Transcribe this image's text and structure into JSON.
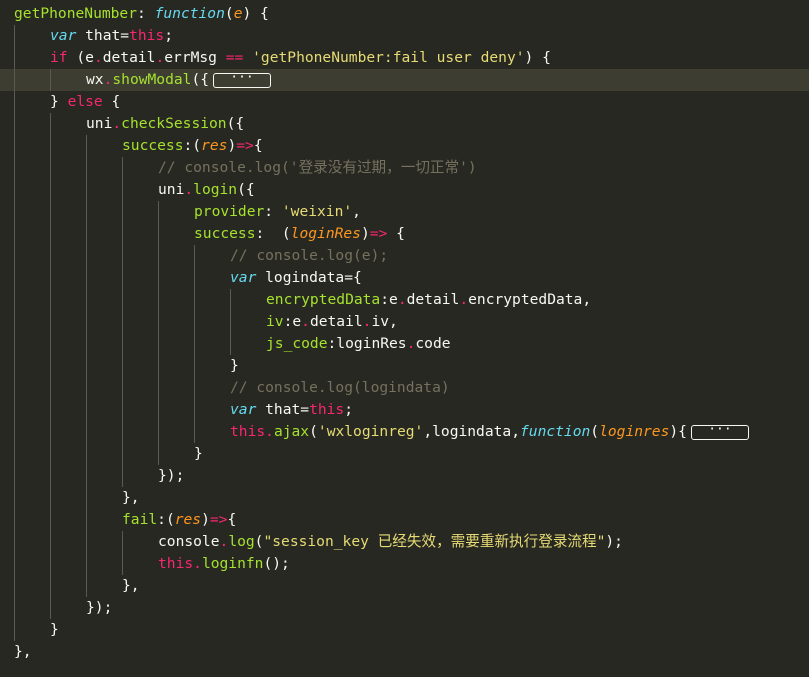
{
  "colors": {
    "background": "#272822",
    "keyword": "#f92672",
    "plain": "#f8f8f2",
    "function_name": "#a6e22e",
    "storage": "#66d9ef",
    "string": "#e6db74",
    "param": "#fd971f",
    "comment": "#75715e",
    "punct": "#f8f8f2"
  },
  "code_lines": [
    {
      "indent": 0,
      "tokens": [
        [
          "getPhoneNumber",
          "function_name"
        ],
        [
          ": ",
          "plain"
        ],
        [
          "function",
          "storage",
          true
        ],
        [
          "(",
          "plain"
        ],
        [
          "e",
          "param",
          true
        ],
        [
          ") {",
          "plain"
        ]
      ]
    },
    {
      "indent": 1,
      "tokens": [
        [
          "var",
          "storage",
          true
        ],
        [
          " that=",
          "plain"
        ],
        [
          "this",
          "keyword"
        ],
        [
          ";",
          "plain"
        ]
      ]
    },
    {
      "indent": 1,
      "tokens": [
        [
          "if",
          "keyword"
        ],
        [
          " (e",
          "plain"
        ],
        [
          ".",
          "keyword"
        ],
        [
          "detail",
          "plain"
        ],
        [
          ".",
          "keyword"
        ],
        [
          "errMsg ",
          "plain"
        ],
        [
          "==",
          "keyword"
        ],
        [
          " ",
          "plain"
        ],
        [
          "'getPhoneNumber:fail user deny'",
          "string"
        ],
        [
          ") {",
          "plain"
        ]
      ]
    },
    {
      "indent": 2,
      "active": true,
      "fold": "···",
      "tokens": [
        [
          "wx",
          "plain"
        ],
        [
          ".",
          "keyword"
        ],
        [
          "showModal",
          "function_name"
        ],
        [
          "({",
          "plain"
        ]
      ]
    },
    {
      "indent": 1,
      "tokens": [
        [
          "} ",
          "plain"
        ],
        [
          "else",
          "keyword"
        ],
        [
          " {",
          "plain"
        ]
      ]
    },
    {
      "indent": 2,
      "tokens": [
        [
          "uni",
          "plain"
        ],
        [
          ".",
          "keyword"
        ],
        [
          "checkSession",
          "function_name"
        ],
        [
          "({",
          "plain"
        ]
      ]
    },
    {
      "indent": 3,
      "tokens": [
        [
          "success",
          "function_name"
        ],
        [
          ":(",
          "plain"
        ],
        [
          "res",
          "param",
          true
        ],
        [
          ")",
          "plain"
        ],
        [
          "=>",
          "keyword"
        ],
        [
          "{",
          "plain"
        ]
      ]
    },
    {
      "indent": 4,
      "tokens": [
        [
          "// console.log('登录没有过期，一切正常')",
          "comment"
        ]
      ]
    },
    {
      "indent": 4,
      "tokens": [
        [
          "uni",
          "plain"
        ],
        [
          ".",
          "keyword"
        ],
        [
          "login",
          "function_name"
        ],
        [
          "({",
          "plain"
        ]
      ]
    },
    {
      "indent": 5,
      "tokens": [
        [
          "provider",
          "function_name"
        ],
        [
          ": ",
          "plain"
        ],
        [
          "'weixin'",
          "string"
        ],
        [
          ",",
          "plain"
        ]
      ]
    },
    {
      "indent": 5,
      "tokens": [
        [
          "success",
          "function_name"
        ],
        [
          ":  (",
          "plain"
        ],
        [
          "loginRes",
          "param",
          true
        ],
        [
          ")",
          "plain"
        ],
        [
          "=>",
          "keyword"
        ],
        [
          " {",
          "plain"
        ]
      ]
    },
    {
      "indent": 6,
      "tokens": [
        [
          "// console.log(e);",
          "comment"
        ]
      ]
    },
    {
      "indent": 6,
      "tokens": [
        [
          "var",
          "storage",
          true
        ],
        [
          " logindata={",
          "plain"
        ]
      ]
    },
    {
      "indent": 7,
      "tokens": [
        [
          "encryptedData",
          "function_name"
        ],
        [
          ":e",
          "plain"
        ],
        [
          ".",
          "keyword"
        ],
        [
          "detail",
          "plain"
        ],
        [
          ".",
          "keyword"
        ],
        [
          "encryptedData,",
          "plain"
        ]
      ]
    },
    {
      "indent": 7,
      "tokens": [
        [
          "iv",
          "function_name"
        ],
        [
          ":e",
          "plain"
        ],
        [
          ".",
          "keyword"
        ],
        [
          "detail",
          "plain"
        ],
        [
          ".",
          "keyword"
        ],
        [
          "iv,",
          "plain"
        ]
      ]
    },
    {
      "indent": 7,
      "tokens": [
        [
          "js_code",
          "function_name"
        ],
        [
          ":loginRes",
          "plain"
        ],
        [
          ".",
          "keyword"
        ],
        [
          "code",
          "plain"
        ]
      ]
    },
    {
      "indent": 6,
      "tokens": [
        [
          "}",
          "plain"
        ]
      ]
    },
    {
      "indent": 6,
      "tokens": [
        [
          "// console.log(logindata)",
          "comment"
        ]
      ]
    },
    {
      "indent": 6,
      "tokens": [
        [
          "var",
          "storage",
          true
        ],
        [
          " that=",
          "plain"
        ],
        [
          "this",
          "keyword"
        ],
        [
          ";",
          "plain"
        ]
      ]
    },
    {
      "indent": 6,
      "fold": "···",
      "tokens": [
        [
          "this",
          "keyword"
        ],
        [
          ".",
          "keyword"
        ],
        [
          "ajax",
          "function_name"
        ],
        [
          "(",
          "plain"
        ],
        [
          "'wxloginreg'",
          "string"
        ],
        [
          ",logindata,",
          "plain"
        ],
        [
          "function",
          "storage",
          true
        ],
        [
          "(",
          "plain"
        ],
        [
          "loginres",
          "param",
          true
        ],
        [
          "){",
          "plain"
        ]
      ]
    },
    {
      "indent": 5,
      "tokens": [
        [
          "}",
          "plain"
        ]
      ]
    },
    {
      "indent": 4,
      "tokens": [
        [
          "});",
          "plain"
        ]
      ]
    },
    {
      "indent": 3,
      "tokens": [
        [
          "},",
          "plain"
        ]
      ]
    },
    {
      "indent": 3,
      "tokens": [
        [
          "fail",
          "function_name"
        ],
        [
          ":(",
          "plain"
        ],
        [
          "res",
          "param",
          true
        ],
        [
          ")",
          "plain"
        ],
        [
          "=>",
          "keyword"
        ],
        [
          "{",
          "plain"
        ]
      ]
    },
    {
      "indent": 4,
      "tokens": [
        [
          "console",
          "plain"
        ],
        [
          ".",
          "keyword"
        ],
        [
          "log",
          "function_name"
        ],
        [
          "(",
          "plain"
        ],
        [
          "\"session_key 已经失效，需要重新执行登录流程\"",
          "string"
        ],
        [
          ");",
          "plain"
        ]
      ]
    },
    {
      "indent": 4,
      "tokens": [
        [
          "this",
          "keyword"
        ],
        [
          ".",
          "keyword"
        ],
        [
          "loginfn",
          "function_name"
        ],
        [
          "();",
          "plain"
        ]
      ]
    },
    {
      "indent": 3,
      "tokens": [
        [
          "},",
          "plain"
        ]
      ]
    },
    {
      "indent": 2,
      "tokens": [
        [
          "});",
          "plain"
        ]
      ]
    },
    {
      "indent": 1,
      "tokens": [
        [
          "}",
          "plain"
        ]
      ]
    },
    {
      "indent": 0,
      "tokens": [
        [
          "},",
          "plain"
        ]
      ]
    }
  ]
}
